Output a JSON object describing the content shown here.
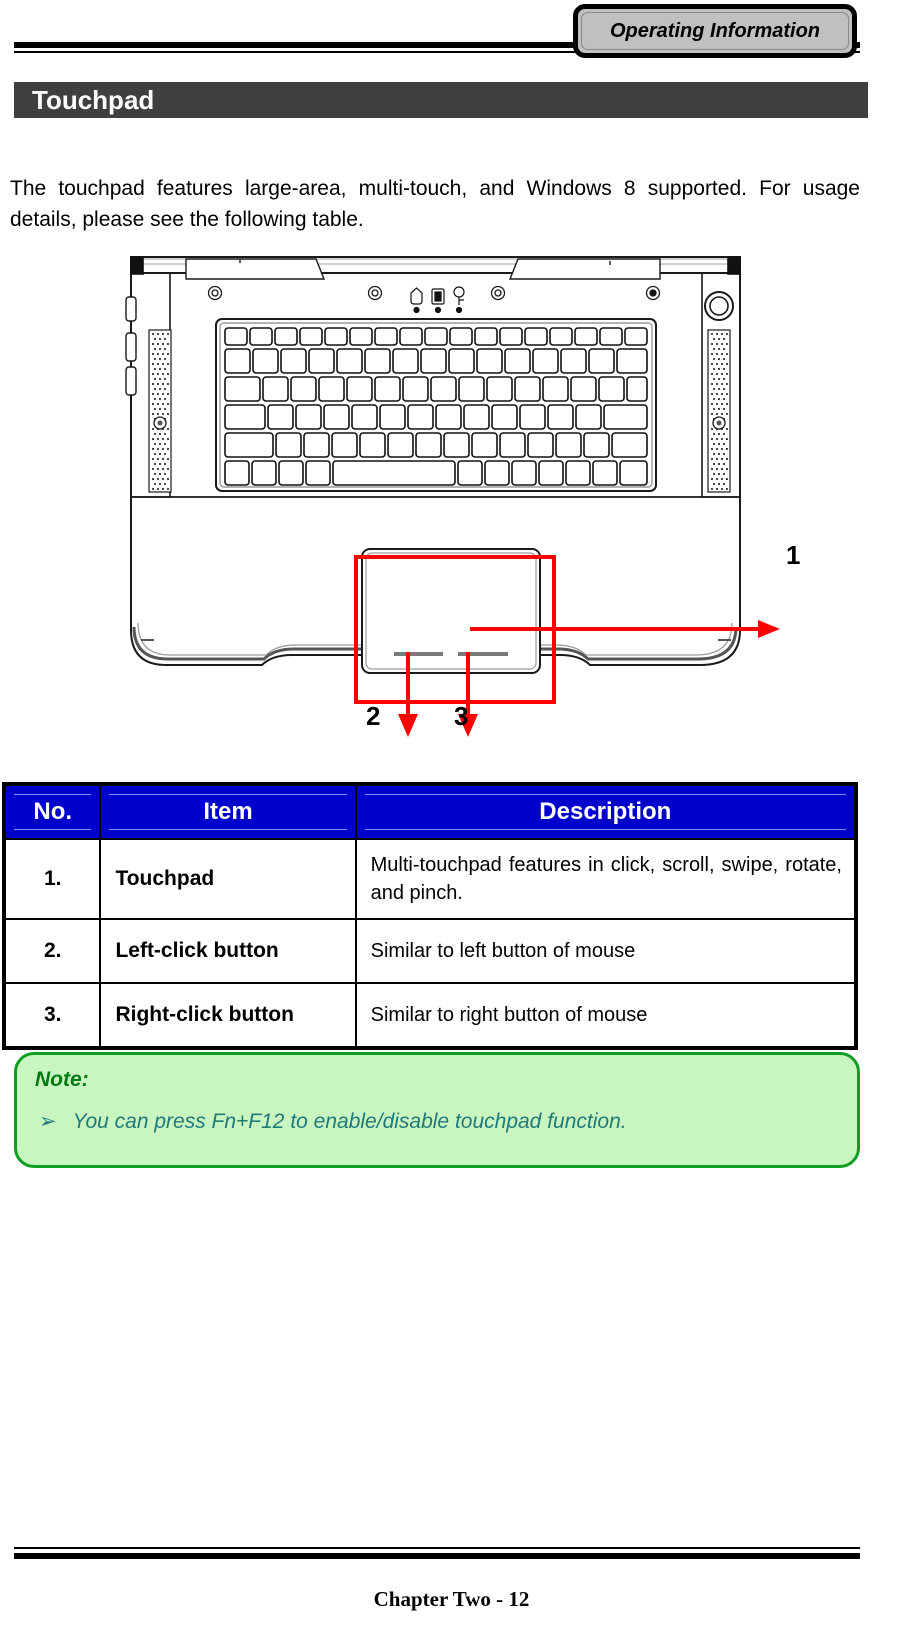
{
  "header": {
    "tab_label": "Operating Information"
  },
  "section": {
    "title": "Touchpad"
  },
  "intro": {
    "paragraph": "The touchpad features large-area, multi-touch, and Windows 8 supported. For usage details, please see the following table."
  },
  "figure": {
    "alt": "laptop-top-view-diagram",
    "callouts": [
      {
        "number": "1",
        "target": "touchpad"
      },
      {
        "number": "2",
        "target": "left-click-button"
      },
      {
        "number": "3",
        "target": "right-click-button"
      }
    ],
    "highlight_color": "#ff0000"
  },
  "table": {
    "headers": [
      "No.",
      "Item",
      "Description"
    ],
    "header_bg": "#0000cc",
    "header_fg": "#ffffff",
    "rows": [
      {
        "no": "1.",
        "item": "Touchpad",
        "description": "Multi-touchpad features in click, scroll, swipe, rotate, and pinch."
      },
      {
        "no": "2.",
        "item": "Left-click button",
        "description": "Similar to left button of mouse"
      },
      {
        "no": "3.",
        "item": "Right-click button",
        "description": "Similar to right button of mouse"
      }
    ]
  },
  "note": {
    "title": "Note:",
    "bullet_glyph": "➢",
    "items": [
      "You can press Fn+F12 to enable/disable touchpad function."
    ],
    "bg": "#c9f5c0",
    "border": "#0f9e22",
    "title_color": "#007a14",
    "text_color": "#1f7a7a"
  },
  "footer": {
    "page_label": "Chapter Two - 12"
  }
}
